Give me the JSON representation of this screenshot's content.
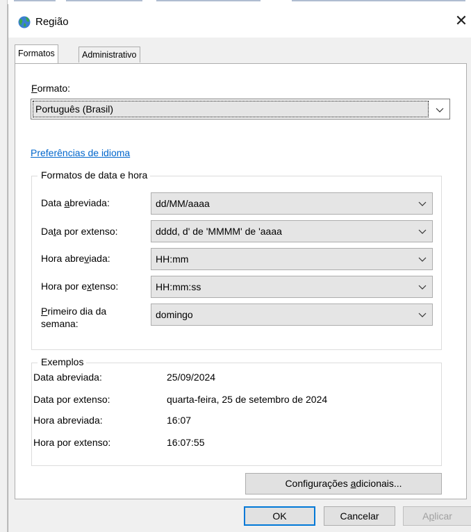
{
  "window": {
    "title": "Região",
    "close_glyph": "✕"
  },
  "tabs": [
    {
      "label": "Formatos",
      "active": true
    },
    {
      "label": "Administrativo",
      "active": false
    }
  ],
  "format": {
    "label_key": "F",
    "label_rest": "ormato:",
    "value": "Português (Brasil)"
  },
  "language_link": "Preferências de idioma",
  "date_time_group": {
    "legend": "Formatos de data e hora",
    "rows": [
      {
        "label_pre": "Data ",
        "label_key": "a",
        "label_post": "breviada:",
        "value": "dd/MM/aaaa"
      },
      {
        "label_pre": "Da",
        "label_key": "t",
        "label_post": "a por extenso:",
        "value": "dddd, d' de 'MMMM' de 'aaaa"
      },
      {
        "label_pre": "Hora abre",
        "label_key": "v",
        "label_post": "iada:",
        "value": "HH:mm"
      },
      {
        "label_pre": "Hora por e",
        "label_key": "x",
        "label_post": "tenso:",
        "value": "HH:mm:ss"
      }
    ],
    "first_day": {
      "label_key": "P",
      "label_line1": "rimeiro dia da",
      "label_line2": "semana:",
      "value": "domingo"
    }
  },
  "examples": {
    "legend": "Exemplos",
    "rows": [
      {
        "label": "Data abreviada:",
        "value": "25/09/2024"
      },
      {
        "label": "Data por extenso:",
        "value": "quarta-feira, 25 de setembro de 2024"
      },
      {
        "label": "Hora abreviada:",
        "value": "16:07"
      },
      {
        "label": "Hora por extenso:",
        "value": "16:07:55"
      }
    ]
  },
  "buttons": {
    "additional_pre": "Configurações ",
    "additional_key": "a",
    "additional_post": "dicionais...",
    "ok": "OK",
    "cancel": "Cancelar",
    "apply_pre": "A",
    "apply_key": "p",
    "apply_post": "licar"
  },
  "colors": {
    "accent": "#0078d7",
    "link": "#0066cc"
  }
}
